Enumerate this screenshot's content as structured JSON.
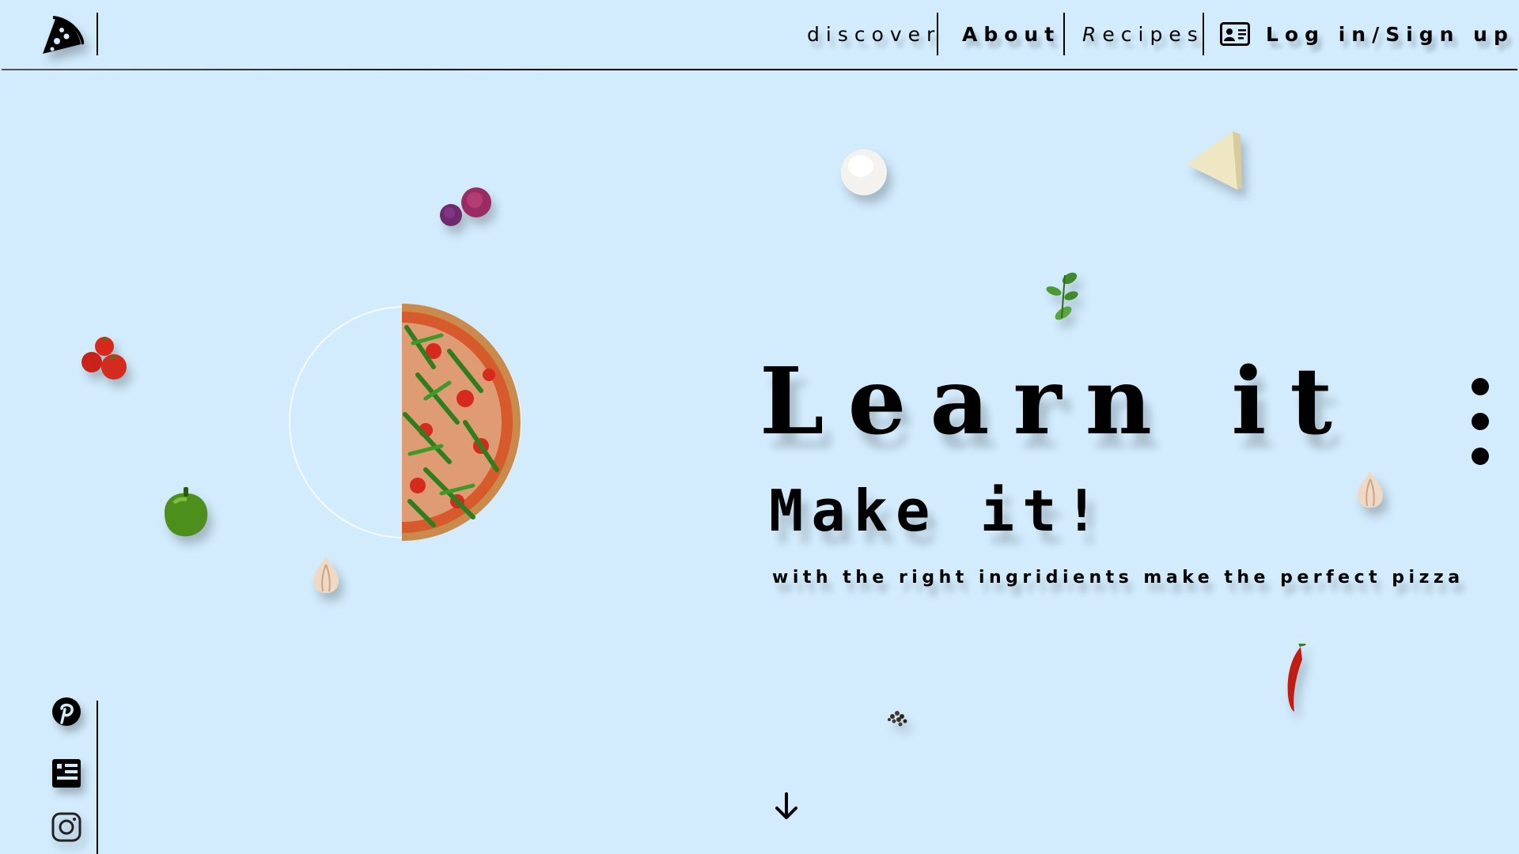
{
  "header": {
    "logo": "pizza-slice-icon",
    "nav": {
      "discover": "discover",
      "about": "About",
      "recipes": "Recipes",
      "login": "Log in/Sign up"
    }
  },
  "hero": {
    "title_line1": "Learn it",
    "title_line2": "Make it!",
    "subtitle": "with the right ingridients make the perfect pizza"
  },
  "social": {
    "items": [
      "pinterest-icon",
      "profile-card-icon",
      "instagram-icon"
    ]
  },
  "colors": {
    "background": "#d2ecfd",
    "text": "#000000"
  }
}
